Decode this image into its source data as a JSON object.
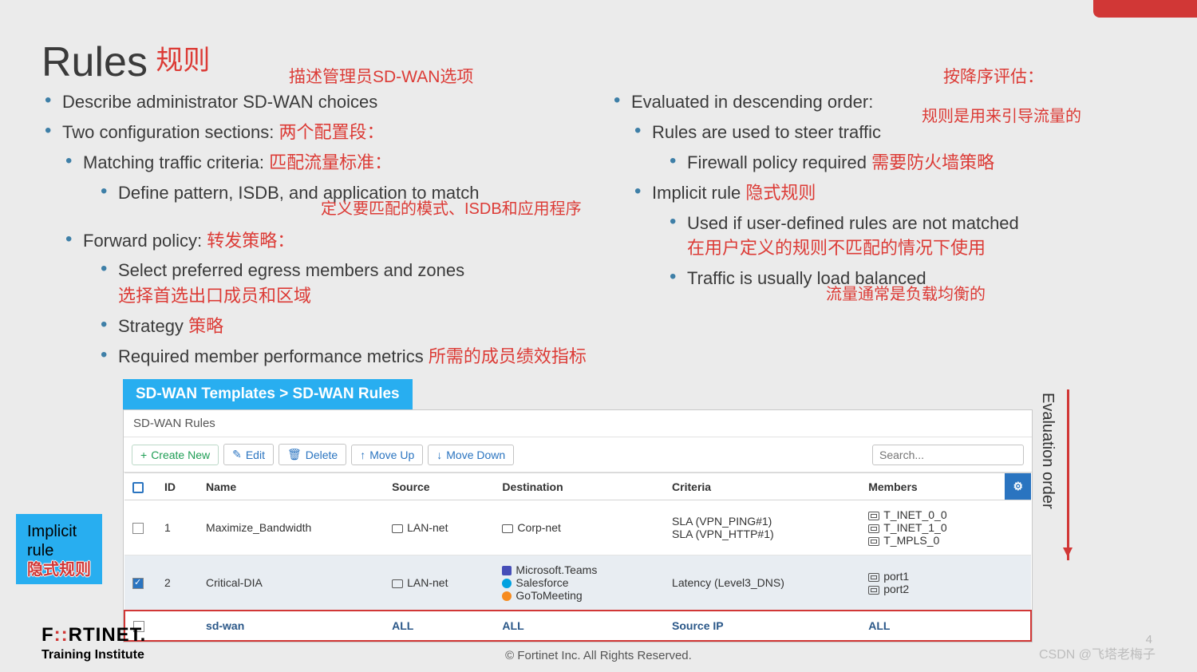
{
  "header": {
    "title_en": "Rules",
    "title_cn": "规则"
  },
  "annotations": {
    "left_top": "描述管理员SD-WAN选项",
    "two_sections_cn": "两个配置段：",
    "matching_cn": "匹配流量标准：",
    "define_cn": "定义要匹配的模式、ISDB和应用程序",
    "forward_cn": "转发策略：",
    "select_cn": "选择首选出口成员和区域",
    "strategy_cn": "策略",
    "metrics_cn": "所需的成员绩效指标",
    "right_top": "按降序评估：",
    "rules_steer_cn": "规则是用来引导流量的",
    "firewall_cn": "需要防火墙策略",
    "implicit_cn": "隐式规则",
    "used_if_cn": "在用户定义的规则不匹配的情况下使用",
    "load_balanced_cn": "流量通常是负载均衡的"
  },
  "left_bullets": {
    "b1": "Describe administrator SD-WAN choices",
    "b2": "Two configuration sections:",
    "b2_1": "Matching traffic criteria:",
    "b2_1_1": "Define pattern, ISDB, and application to match",
    "b2_2": "Forward policy:",
    "b2_2_1": "Select preferred egress members and zones",
    "b2_2_2": "Strategy",
    "b2_2_3": "Required member performance metrics"
  },
  "right_bullets": {
    "b1": "Evaluated in descending order:",
    "b1_1": "Rules are used to steer traffic",
    "b1_1_1": "Firewall policy required",
    "b1_2": "Implicit rule",
    "b1_2_1": "Used if user-defined rules are not matched",
    "b1_2_2": "Traffic is usually load balanced"
  },
  "breadcrumb": "SD-WAN Templates  >  SD-WAN Rules",
  "panel": {
    "title": "SD-WAN Rules",
    "toolbar": {
      "create": "Create New",
      "edit": "Edit",
      "delete": "Delete",
      "move_up": "Move Up",
      "move_down": "Move Down",
      "search_placeholder": "Search..."
    },
    "columns": {
      "id": "ID",
      "name": "Name",
      "source": "Source",
      "destination": "Destination",
      "criteria": "Criteria",
      "members": "Members"
    },
    "rows": [
      {
        "id": "1",
        "name": "Maximize_Bandwidth",
        "source": "LAN-net",
        "destination": [
          "Corp-net"
        ],
        "criteria": [
          "SLA (VPN_PING#1)",
          "SLA (VPN_HTTP#1)"
        ],
        "members": [
          "T_INET_0_0",
          "T_INET_1_0",
          "T_MPLS_0"
        ]
      },
      {
        "id": "2",
        "name": "Critical-DIA",
        "source": "LAN-net",
        "destination": [
          "Microsoft.Teams",
          "Salesforce",
          "GoToMeeting"
        ],
        "criteria": [
          "Latency (Level3_DNS)"
        ],
        "members": [
          "port1",
          "port2"
        ]
      }
    ],
    "implicit_row": {
      "name": "sd-wan",
      "source": "ALL",
      "destination": "ALL",
      "criteria": "Source IP",
      "members": "ALL"
    }
  },
  "implicit_callout": {
    "en_l1": "Implicit",
    "en_l2": "rule",
    "cn": "隐式规则"
  },
  "evaluation_label": "Evaluation order",
  "footer": {
    "logo_text": "FORTINET.",
    "institute": "Training Institute",
    "copyright": "© Fortinet Inc. All Rights Reserved.",
    "watermark": "CSDN @飞塔老梅子",
    "page": "4"
  }
}
